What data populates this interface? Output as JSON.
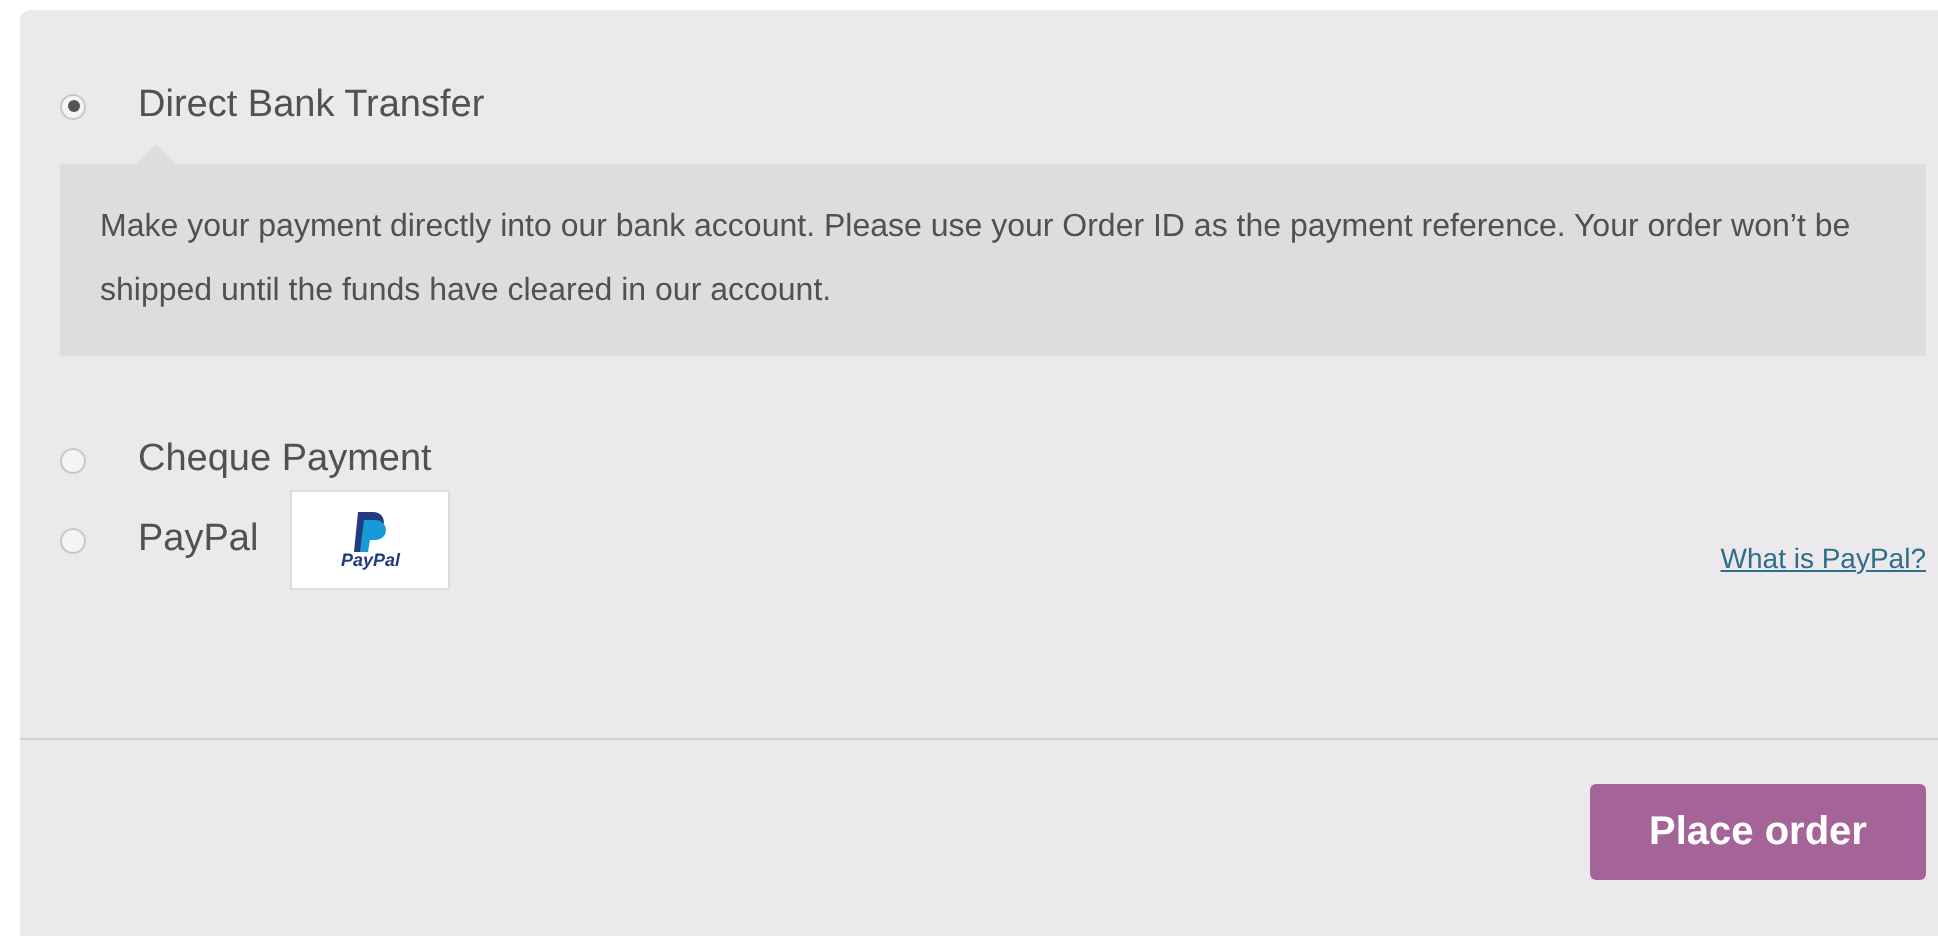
{
  "payment_methods": [
    {
      "label": "Direct Bank Transfer",
      "selected": true,
      "description": "Make your payment directly into our bank account. Please use your Order ID as the payment reference. Your order won’t be shipped until the funds have cleared in our account."
    },
    {
      "label": "Cheque Payment",
      "selected": false
    },
    {
      "label": "PayPal",
      "selected": false,
      "logo_text": "PayPal",
      "link": "What is PayPal?"
    }
  ],
  "place_order_button": "Place order"
}
